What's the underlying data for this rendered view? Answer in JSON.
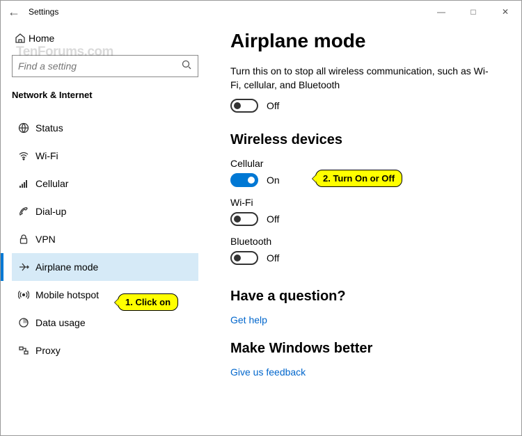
{
  "window": {
    "title": "Settings"
  },
  "sidebar": {
    "home_label": "Home",
    "search_placeholder": "Find a setting",
    "section": "Network & Internet",
    "items": [
      {
        "label": "Status"
      },
      {
        "label": "Wi-Fi"
      },
      {
        "label": "Cellular"
      },
      {
        "label": "Dial-up"
      },
      {
        "label": "VPN"
      },
      {
        "label": "Airplane mode"
      },
      {
        "label": "Mobile hotspot"
      },
      {
        "label": "Data usage"
      },
      {
        "label": "Proxy"
      }
    ]
  },
  "main": {
    "title": "Airplane mode",
    "description": "Turn this on to stop all wireless communication, such as Wi-Fi, cellular, and Bluetooth",
    "master_toggle": {
      "state": "Off"
    },
    "wireless_heading": "Wireless devices",
    "cellular": {
      "label": "Cellular",
      "state": "On"
    },
    "wifi": {
      "label": "Wi-Fi",
      "state": "Off"
    },
    "bluetooth": {
      "label": "Bluetooth",
      "state": "Off"
    },
    "question_heading": "Have a question?",
    "question_link": "Get help",
    "feedback_heading": "Make Windows better",
    "feedback_link": "Give us feedback"
  },
  "annotations": {
    "step1": "1. Click on",
    "step2": "2. Turn On or Off"
  },
  "watermark": "TenForums.com"
}
